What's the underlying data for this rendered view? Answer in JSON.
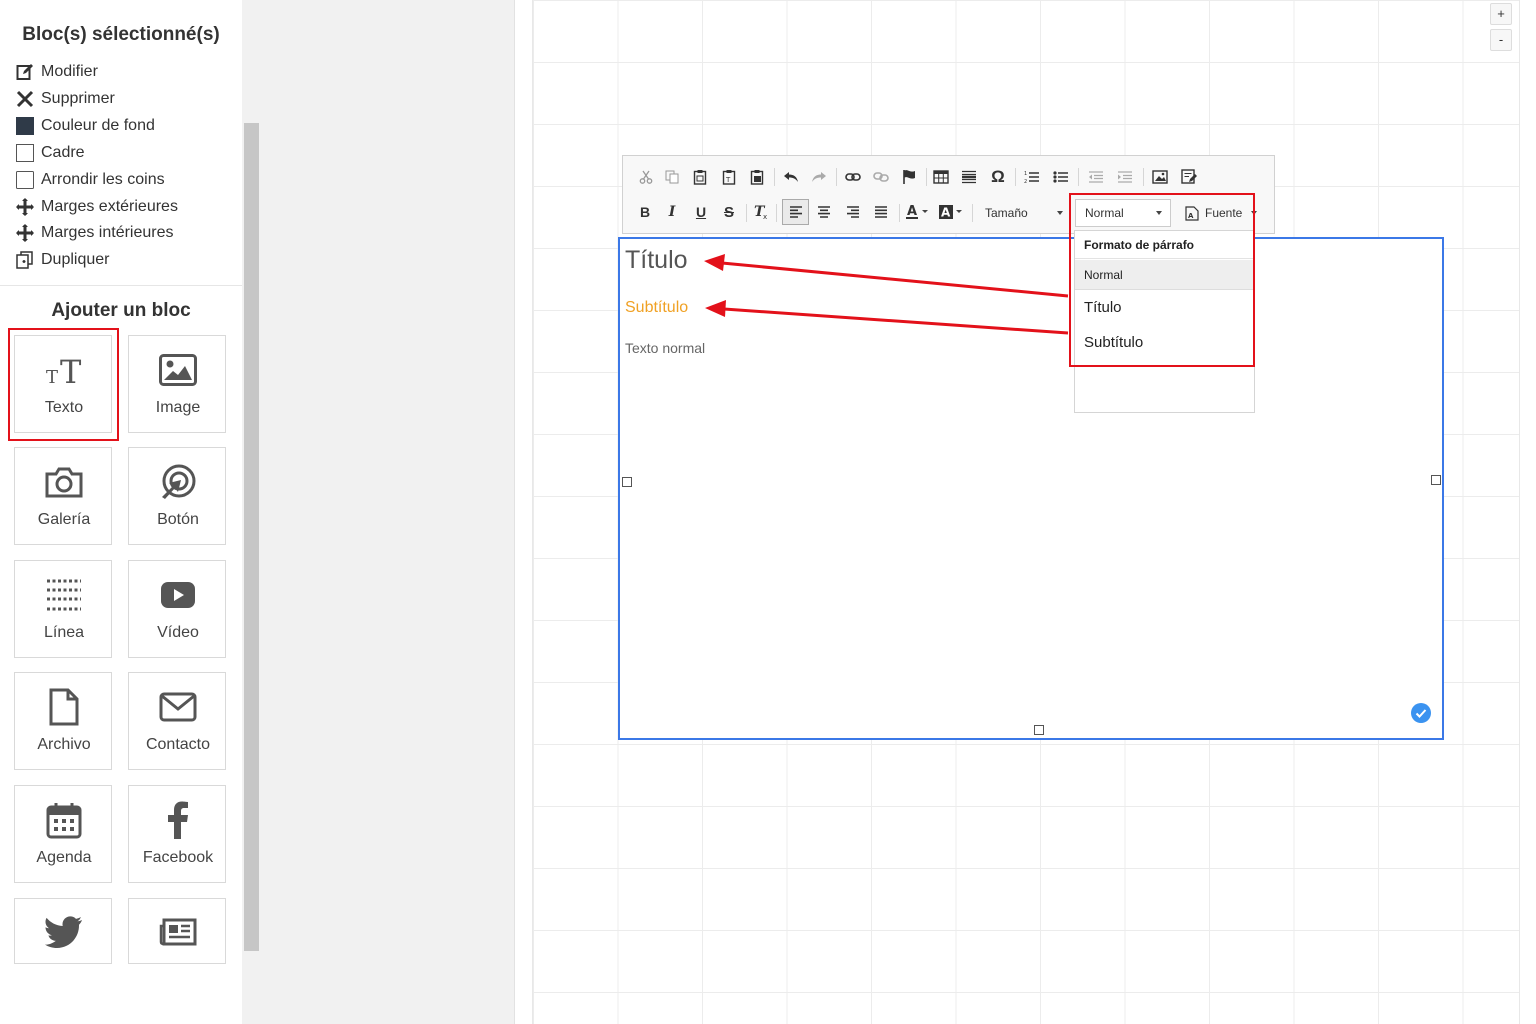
{
  "sidebar": {
    "selected_title": "Bloc(s) sélectionné(s)",
    "actions": [
      {
        "label": "Modifier",
        "icon": "edit-icon"
      },
      {
        "label": "Supprimer",
        "icon": "close-icon"
      },
      {
        "label": "Couleur de fond",
        "icon": "background-color-icon"
      },
      {
        "label": "Cadre",
        "icon": "border-icon"
      },
      {
        "label": "Arrondir les coins",
        "icon": "rounded-corners-icon"
      },
      {
        "label": "Marges extérieures",
        "icon": "outer-margins-icon"
      },
      {
        "label": "Marges intérieures",
        "icon": "inner-margins-icon"
      },
      {
        "label": "Dupliquer",
        "icon": "duplicate-icon"
      }
    ],
    "add_title": "Ajouter un bloc",
    "blocks": [
      {
        "label": "Texto",
        "icon": "text-icon"
      },
      {
        "label": "Image",
        "icon": "image-icon"
      },
      {
        "label": "Galería",
        "icon": "camera-icon"
      },
      {
        "label": "Botón",
        "icon": "button-cursor-icon"
      },
      {
        "label": "Línea",
        "icon": "line-icon"
      },
      {
        "label": "Vídeo",
        "icon": "video-icon"
      },
      {
        "label": "Archivo",
        "icon": "file-icon"
      },
      {
        "label": "Contacto",
        "icon": "envelope-icon"
      },
      {
        "label": "Agenda",
        "icon": "calendar-icon"
      },
      {
        "label": "Facebook",
        "icon": "facebook-icon"
      },
      {
        "label": "",
        "icon": "twitter-icon"
      },
      {
        "label": "",
        "icon": "news-icon"
      }
    ]
  },
  "zoom": {
    "plus": "+",
    "minus": "-"
  },
  "toolbar": {
    "size_label": "Tamaño",
    "format_value": "Normal",
    "font_label": "Fuente"
  },
  "dropdown": {
    "header": "Formato de párrafo",
    "items": [
      "Normal",
      "Título",
      "Subtítulo"
    ]
  },
  "content": {
    "title": "Título",
    "subtitle": "Subtítulo",
    "normal": "Texto normal"
  },
  "colors": {
    "accent_blue": "#3b78e7",
    "highlight_red": "#e3111a",
    "subtitle_orange": "#f0a124"
  }
}
